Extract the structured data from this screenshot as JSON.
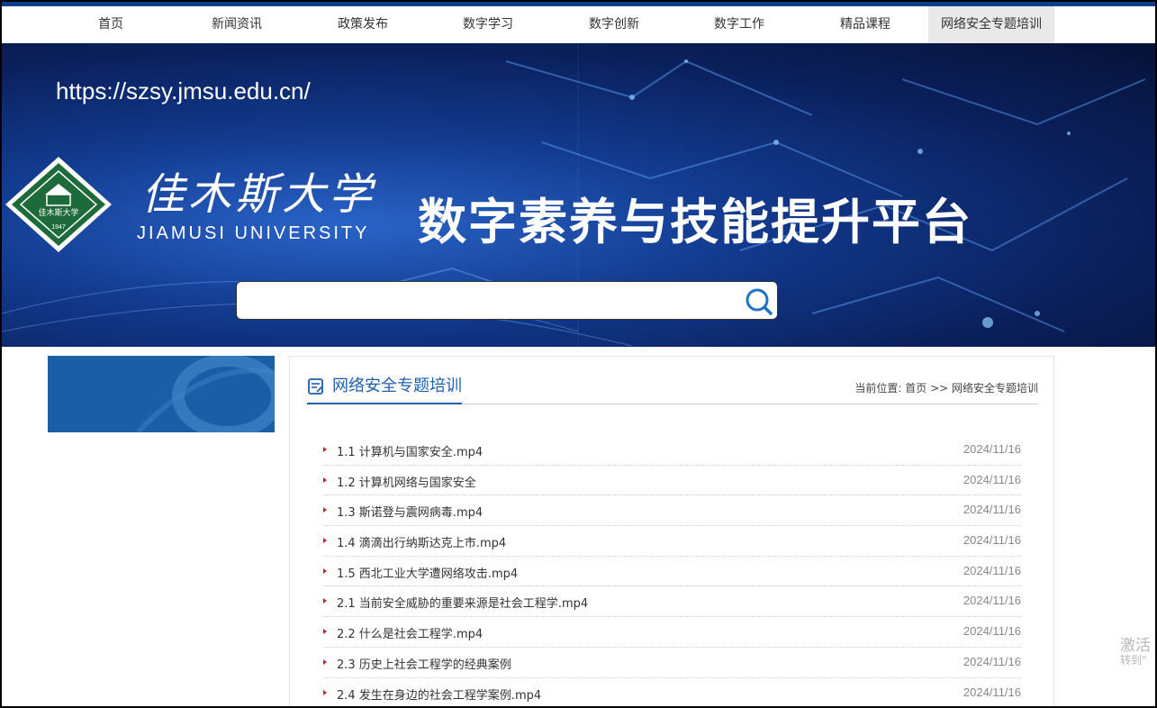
{
  "nav": {
    "items": [
      {
        "label": "首页"
      },
      {
        "label": "新闻资讯"
      },
      {
        "label": "政策发布"
      },
      {
        "label": "数字学习"
      },
      {
        "label": "数字创新"
      },
      {
        "label": "数字工作"
      },
      {
        "label": "精品课程"
      },
      {
        "label": "网络安全专题培训"
      }
    ],
    "active_index": 7
  },
  "banner": {
    "url_text": "https://szsy.jmsu.edu.cn/",
    "logo_year": "1947",
    "university_cn": "佳木斯大学",
    "university_en": "JIAMUSI UNIVERSITY",
    "platform_title": "数字素养与技能提升平台",
    "search_placeholder": ""
  },
  "section": {
    "title": "网络安全专题培训",
    "breadcrumb": "当前位置: 首页 >> 网络安全专题培训"
  },
  "articles": [
    {
      "title": "1.1 计算机与国家安全.mp4",
      "date": "2024/11/16"
    },
    {
      "title": "1.2 计算机网络与国家安全",
      "date": "2024/11/16"
    },
    {
      "title": "1.3 斯诺登与震网病毒.mp4",
      "date": "2024/11/16"
    },
    {
      "title": "1.4 滴滴出行纳斯达克上市.mp4",
      "date": "2024/11/16"
    },
    {
      "title": "1.5 西北工业大学遭网络攻击.mp4",
      "date": "2024/11/16"
    },
    {
      "title": "2.1 当前安全威胁的重要来源是社会工程学.mp4",
      "date": "2024/11/16"
    },
    {
      "title": "2.2 什么是社会工程学.mp4",
      "date": "2024/11/16"
    },
    {
      "title": "2.3 历史上社会工程学的经典案例",
      "date": "2024/11/16"
    },
    {
      "title": "2.4 发生在身边的社会工程学案例.mp4",
      "date": "2024/11/16"
    }
  ],
  "watermark": {
    "line1": "激活",
    "line2": "转到\""
  },
  "colors": {
    "nav_active_bg": "#e9e9e9",
    "accent": "#1e5fae",
    "bullet": "#c0262c",
    "banner_dark": "#0a1f5a"
  }
}
